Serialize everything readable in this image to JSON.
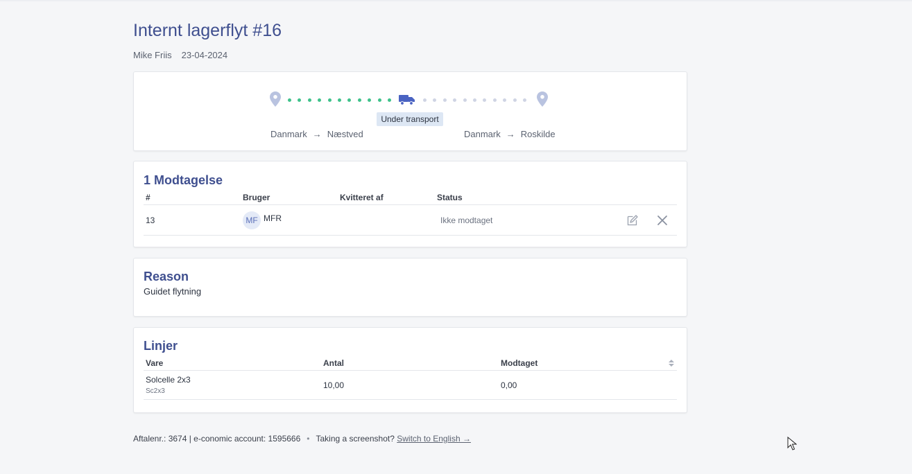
{
  "header": {
    "title": "Internt lagerflyt #16",
    "author": "Mike Friis",
    "date": "23-04-2024"
  },
  "transport": {
    "status_badge": "Under transport",
    "from": {
      "country": "Danmark",
      "arrow": "→",
      "location": "Næstved"
    },
    "to": {
      "country": "Danmark",
      "arrow": "→",
      "location": "Roskilde"
    },
    "progress_colors": {
      "done": "#3ec28a",
      "pending": "#cfd4e4",
      "truck": "#4a63c2"
    }
  },
  "receipts": {
    "heading": "1 Modtagelse",
    "columns": [
      "#",
      "Bruger",
      "Kvitteret af",
      "Status"
    ],
    "rows": [
      {
        "number": "13",
        "avatar": "MF",
        "user": "MFR",
        "acknowledged_by": "",
        "status": "Ikke modtaget"
      }
    ]
  },
  "reason": {
    "heading": "Reason",
    "text": "Guidet flytning"
  },
  "lines": {
    "heading": "Linjer",
    "columns": [
      "Vare",
      "Antal",
      "Modtaget"
    ],
    "rows": [
      {
        "item": "Solcelle 2x3",
        "sku": "Sc2x3",
        "quantity": "10,00",
        "received": "0,00"
      }
    ]
  },
  "footer": {
    "account_info": "Aftalenr.: 3674 | e-conomic account: 1595666",
    "separator": "•",
    "prompt": "Taking a screenshot?",
    "switch_link": "Switch to English →"
  },
  "icons": [
    "location-pin-icon",
    "truck-icon",
    "edit-icon",
    "close-icon",
    "sort-icon",
    "mouse-cursor-icon"
  ]
}
